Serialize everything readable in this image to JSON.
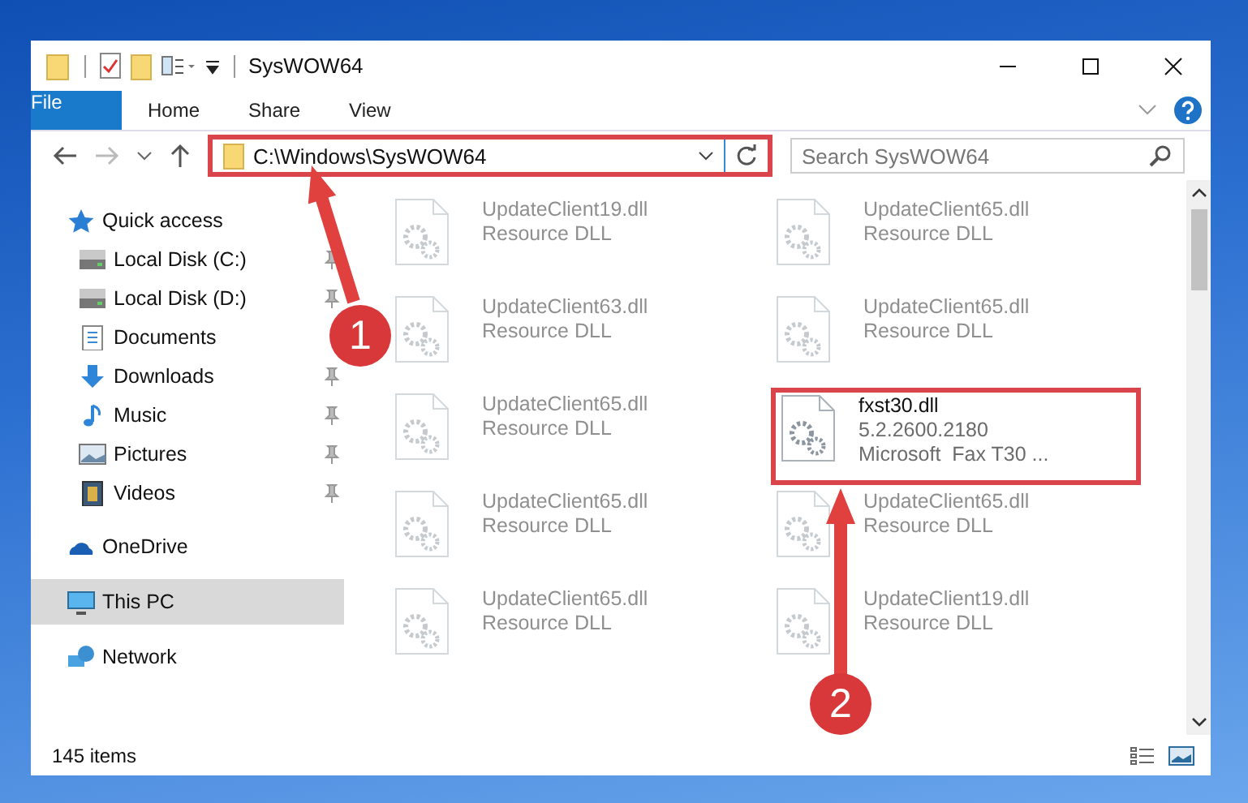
{
  "window": {
    "title": "SysWOW64"
  },
  "ribbon_tabs": [
    {
      "label": "File",
      "selected": true
    },
    {
      "label": "Home",
      "selected": false
    },
    {
      "label": "Share",
      "selected": false
    },
    {
      "label": "View",
      "selected": false
    }
  ],
  "address": {
    "path": "C:\\Windows\\SysWOW64",
    "highlighted": true
  },
  "search": {
    "placeholder": "Search SysWOW64"
  },
  "sidebar": {
    "items": [
      {
        "label": "Quick access",
        "kind": "star",
        "selected": false,
        "children": [
          {
            "label": "Local Disk (C:)",
            "kind": "drive",
            "pinned": true
          },
          {
            "label": "Local Disk (D:)",
            "kind": "drive",
            "pinned": true
          },
          {
            "label": "Documents",
            "kind": "documents",
            "pinned": false
          },
          {
            "label": "Downloads",
            "kind": "downloads",
            "pinned": true
          },
          {
            "label": "Music",
            "kind": "music",
            "pinned": true
          },
          {
            "label": "Pictures",
            "kind": "pictures",
            "pinned": true
          },
          {
            "label": "Videos",
            "kind": "videos",
            "pinned": true
          }
        ]
      },
      {
        "label": "OneDrive",
        "kind": "cloud",
        "selected": false
      },
      {
        "label": "This PC",
        "kind": "pc",
        "selected": true
      },
      {
        "label": "Network",
        "kind": "network",
        "selected": false
      }
    ]
  },
  "files": [
    {
      "name": "UpdateClient19.dll",
      "details": [
        "Resource DLL"
      ],
      "blurred": true,
      "highlighted": false
    },
    {
      "name": "UpdateClient65.dll",
      "details": [
        "Resource DLL"
      ],
      "blurred": true,
      "highlighted": false
    },
    {
      "name": "UpdateClient63.dll",
      "details": [
        "Resource DLL"
      ],
      "blurred": true,
      "highlighted": false
    },
    {
      "name": "UpdateClient65.dll",
      "details": [
        "Resource DLL"
      ],
      "blurred": true,
      "highlighted": false
    },
    {
      "name": "UpdateClient65.dll",
      "details": [
        "Resource DLL"
      ],
      "blurred": true,
      "highlighted": false
    },
    {
      "name": "fxst30.dll",
      "details": [
        "5.2.2600.2180",
        "Microsoft  Fax T30 ..."
      ],
      "blurred": false,
      "highlighted": true
    },
    {
      "name": "UpdateClient65.dll",
      "details": [
        "Resource DLL"
      ],
      "blurred": true,
      "highlighted": false
    },
    {
      "name": "UpdateClient65.dll",
      "details": [
        "Resource DLL"
      ],
      "blurred": true,
      "highlighted": false
    },
    {
      "name": "UpdateClient65.dll",
      "details": [
        "Resource DLL"
      ],
      "blurred": true,
      "highlighted": false
    },
    {
      "name": "UpdateClient19.dll",
      "details": [
        "Resource DLL"
      ],
      "blurred": true,
      "highlighted": false
    }
  ],
  "status_bar": {
    "item_count": "145 items"
  },
  "callouts": [
    {
      "label": "1"
    },
    {
      "label": "2"
    }
  ]
}
